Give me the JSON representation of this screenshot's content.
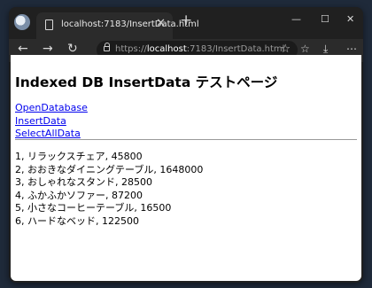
{
  "browser": {
    "tab_title": "localhost:7183/InsertData.html",
    "address": {
      "scheme": "https://",
      "host": "localhost",
      "rest": ":7183/InsertData.html"
    }
  },
  "page": {
    "heading": "Indexed DB InsertData テストページ",
    "links": [
      "OpenDatabase",
      "InsertData",
      "SelectAllData"
    ],
    "results": [
      "1, リラックスチェア, 45800",
      "2, おおきなダイニングテーブル, 1648000",
      "3, おしゃれなスタンド, 28500",
      "4, ふかふかソファー, 87200",
      "5, 小さなコーヒーテーブル, 16500",
      "6, ハードなベッド, 122500"
    ]
  }
}
